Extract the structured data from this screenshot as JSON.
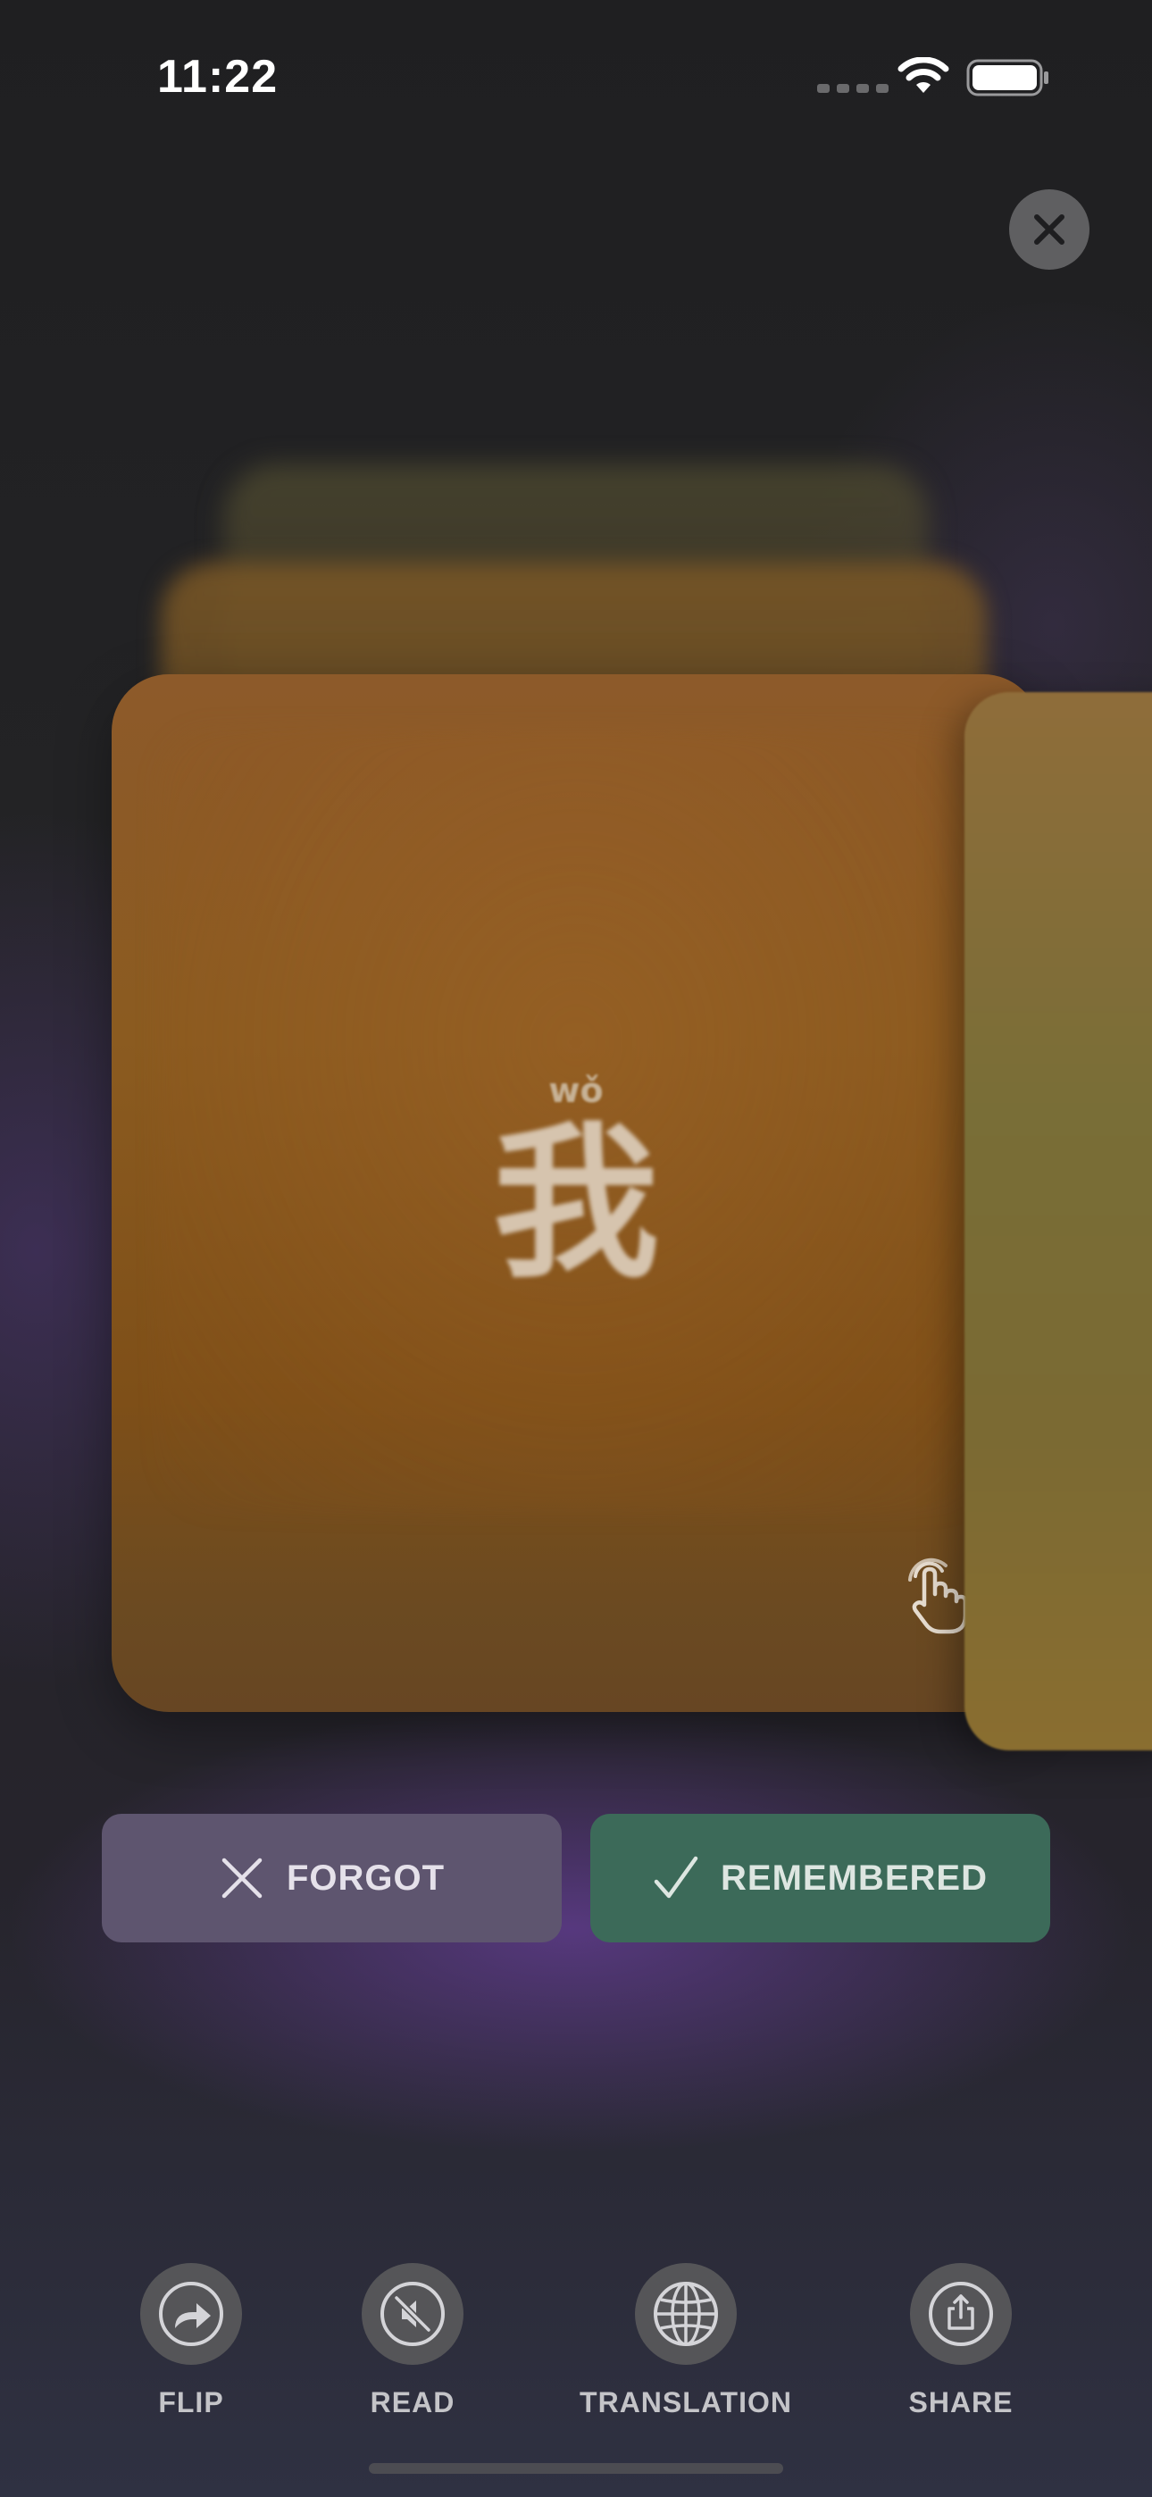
{
  "status_bar": {
    "time": "11:22"
  },
  "icons": {
    "close": "close-icon",
    "tap": "tap-hand-icon",
    "flip": "flip-icon",
    "read": "speaker-muted-icon",
    "translation": "globe-icon",
    "share": "share-icon",
    "forgot": "x-icon",
    "remembered": "checkmark-icon"
  },
  "card": {
    "pinyin": "wǒ",
    "character": "我"
  },
  "actions": {
    "forgot_label": "FORGOT",
    "remembered_label": "REMEMBERED"
  },
  "toolbar": {
    "flip_label": "FLIP",
    "read_label": "READ",
    "translation_label": "TRANSLATION",
    "share_label": "SHARE"
  },
  "colors": {
    "card": "#8b5b20",
    "forgot_button": "#5e556f",
    "remembered_button": "#3c6a59",
    "background": "#222224"
  }
}
